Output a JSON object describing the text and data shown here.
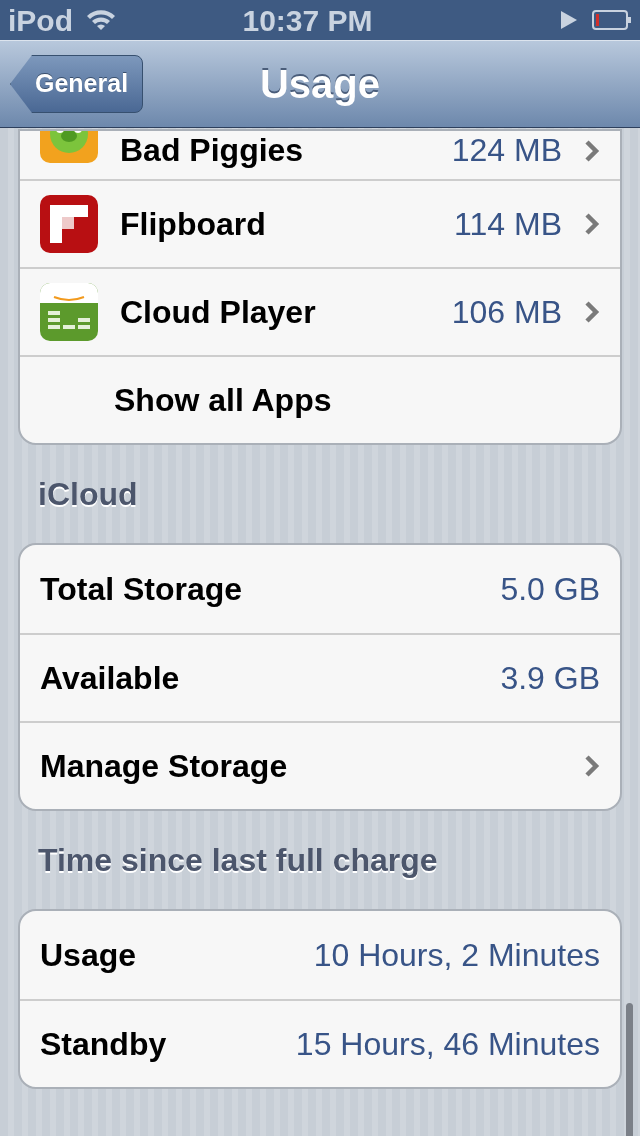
{
  "status_bar": {
    "carrier": "iPod",
    "time": "10:37 PM"
  },
  "nav_bar": {
    "back_button": "General",
    "title": "Usage"
  },
  "apps": {
    "rows": [
      {
        "name": "Bad Piggies",
        "size": "124 MB"
      },
      {
        "name": "Flipboard",
        "size": "114 MB"
      },
      {
        "name": "Cloud Player",
        "size": "106 MB"
      }
    ],
    "show_all": "Show all Apps"
  },
  "icloud": {
    "header": "iCloud",
    "rows": [
      {
        "label": "Total Storage",
        "value": "5.0 GB",
        "disclosure": false
      },
      {
        "label": "Available",
        "value": "3.9 GB",
        "disclosure": false
      },
      {
        "label": "Manage Storage",
        "disclosure": true
      }
    ]
  },
  "battery": {
    "header": "Time since last full charge",
    "rows": [
      {
        "label": "Usage",
        "value": "10 Hours, 2 Minutes",
        "disclosure": false
      },
      {
        "label": "Standby",
        "value": "15 Hours, 46 Minutes",
        "disclosure": false
      }
    ]
  }
}
